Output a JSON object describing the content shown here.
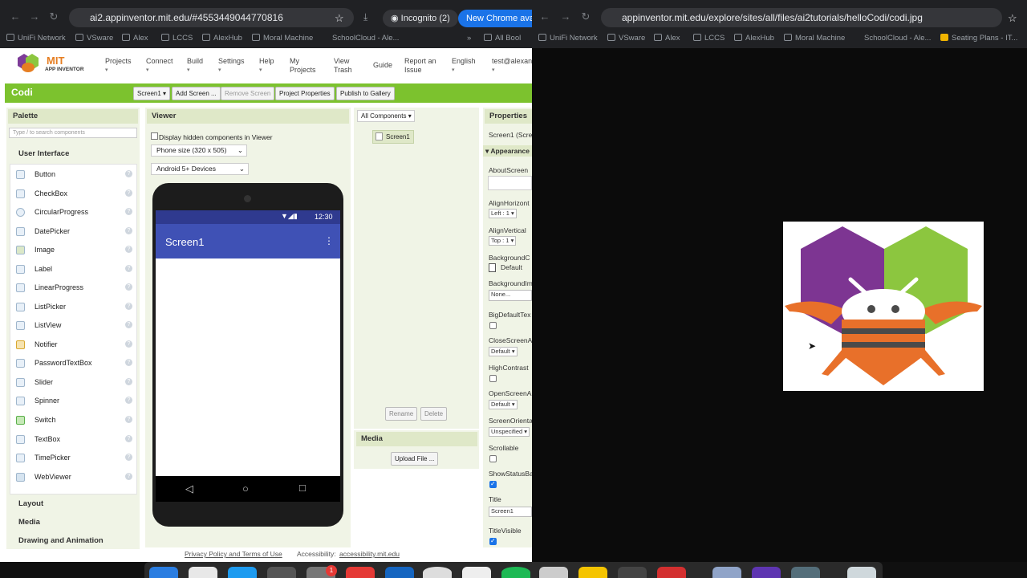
{
  "left_browser": {
    "url": "ai2.appinventor.mit.edu/#4553449044770816",
    "incognito_label": "Incognito (2)",
    "update_label": "New Chrome availa",
    "bookmarks": [
      "UniFi Network",
      "VSware",
      "Alex",
      "LCCS",
      "AlexHub",
      "Moral Machine",
      "SchoolCloud - Ale...",
      "All Bool"
    ]
  },
  "right_browser": {
    "url": "appinventor.mit.edu/explore/sites/all/files/ai2tutorials/helloCodi/codi.jpg",
    "bookmarks": [
      "UniFi Network",
      "VSware",
      "Alex",
      "LCCS",
      "AlexHub",
      "Moral Machine",
      "SchoolCloud - Ale...",
      "Seating Plans - IT..."
    ]
  },
  "app": {
    "logo_top": "MIT",
    "logo_sub": "APP INVENTOR",
    "menu": [
      "Projects",
      "Connect",
      "Build",
      "Settings",
      "Help",
      "My Projects",
      "View Trash",
      "Guide",
      "Report an Issue",
      "English",
      "test@alexan"
    ],
    "project_name": "Codi",
    "toolbar": [
      "Screen1 ▾",
      "Add Screen ...",
      "Remove Screen",
      "Project Properties",
      "Publish to Gallery"
    ],
    "palette": {
      "title": "Palette",
      "search_placeholder": "Type / to search components",
      "category": "User Interface",
      "items": [
        "Button",
        "CheckBox",
        "CircularProgress",
        "DatePicker",
        "Image",
        "Label",
        "LinearProgress",
        "ListPicker",
        "ListView",
        "Notifier",
        "PasswordTextBox",
        "Slider",
        "Spinner",
        "Switch",
        "TextBox",
        "TimePicker",
        "WebViewer"
      ],
      "more_categories": [
        "Layout",
        "Media",
        "Drawing and Animation"
      ]
    },
    "viewer": {
      "title": "Viewer",
      "hidden_label": "Display hidden components in Viewer",
      "size_select": "Phone size (320 x 505)",
      "device_select": "Android 5+ Devices",
      "status_time": "12:30",
      "screen_title": "Screen1"
    },
    "components": {
      "title": "All Components ▾",
      "item": "Screen1",
      "rename": "Rename",
      "delete": "Delete"
    },
    "media": {
      "title": "Media",
      "upload": "Upload File ..."
    },
    "properties": {
      "title": "Properties",
      "subtitle": "Screen1 (Scre",
      "section": "Appearance",
      "about": "AboutScreen",
      "align_h": "AlignHorizont",
      "align_h_val": "Left : 1 ▾",
      "align_v": "AlignVertical",
      "align_v_val": "Top : 1 ▾",
      "bg_color": "BackgroundC",
      "bg_color_val": "Default",
      "bg_image": "BackgroundIm",
      "bg_image_val": "None...",
      "big_text": "BigDefaultTex",
      "close_anim": "CloseScreenA",
      "close_anim_val": "Default ▾",
      "high_contrast": "HighContrast",
      "open_anim": "OpenScreenA",
      "open_anim_val": "Default ▾",
      "orientation": "ScreenOrienta",
      "orientation_val": "Unspecified ▾",
      "scrollable": "Scrollable",
      "show_status": "ShowStatusBa",
      "title_label": "Title",
      "title_val": "Screen1",
      "title_visible": "TitleVisible"
    },
    "footer": {
      "privacy": "Privacy Policy and Terms of Use",
      "accessibility_label": "Accessibility:",
      "accessibility_link": "accessibility.mit.edu"
    }
  },
  "dock_badge": "1"
}
